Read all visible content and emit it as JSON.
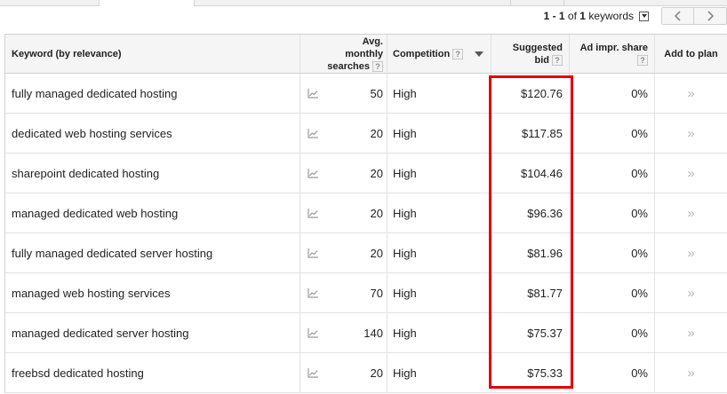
{
  "pagination": {
    "range": "1 - 1",
    "of_label": "of",
    "total": "1",
    "unit": "keywords",
    "prev_icon": "chevron-left-icon",
    "next_icon": "chevron-right-icon"
  },
  "table": {
    "headers": {
      "keyword": "Keyword (by relevance)",
      "avg_line1": "Avg. monthly",
      "avg_line2": "searches",
      "competition": "Competition",
      "bid_line1": "Suggested",
      "bid_line2": "bid",
      "impr": "Ad impr. share",
      "add": "Add to plan",
      "help": "?"
    },
    "rows": [
      {
        "keyword": "fully managed dedicated hosting",
        "searches": "50",
        "competition": "High",
        "bid": "$120.76",
        "impr": "0%",
        "add": "»"
      },
      {
        "keyword": "dedicated web hosting services",
        "searches": "20",
        "competition": "High",
        "bid": "$117.85",
        "impr": "0%",
        "add": "»"
      },
      {
        "keyword": "sharepoint dedicated hosting",
        "searches": "20",
        "competition": "High",
        "bid": "$104.46",
        "impr": "0%",
        "add": "»"
      },
      {
        "keyword": "managed dedicated web hosting",
        "searches": "20",
        "competition": "High",
        "bid": "$96.36",
        "impr": "0%",
        "add": "»"
      },
      {
        "keyword": "fully managed dedicated server hosting",
        "searches": "20",
        "competition": "High",
        "bid": "$81.96",
        "impr": "0%",
        "add": "»"
      },
      {
        "keyword": "managed web hosting services",
        "searches": "70",
        "competition": "High",
        "bid": "$81.77",
        "impr": "0%",
        "add": "»"
      },
      {
        "keyword": "managed dedicated server hosting",
        "searches": "140",
        "competition": "High",
        "bid": "$75.37",
        "impr": "0%",
        "add": "»"
      },
      {
        "keyword": "freebsd dedicated hosting",
        "searches": "20",
        "competition": "High",
        "bid": "$75.33",
        "impr": "0%",
        "add": "»"
      }
    ]
  },
  "annotation": {
    "color": "#e00000"
  }
}
